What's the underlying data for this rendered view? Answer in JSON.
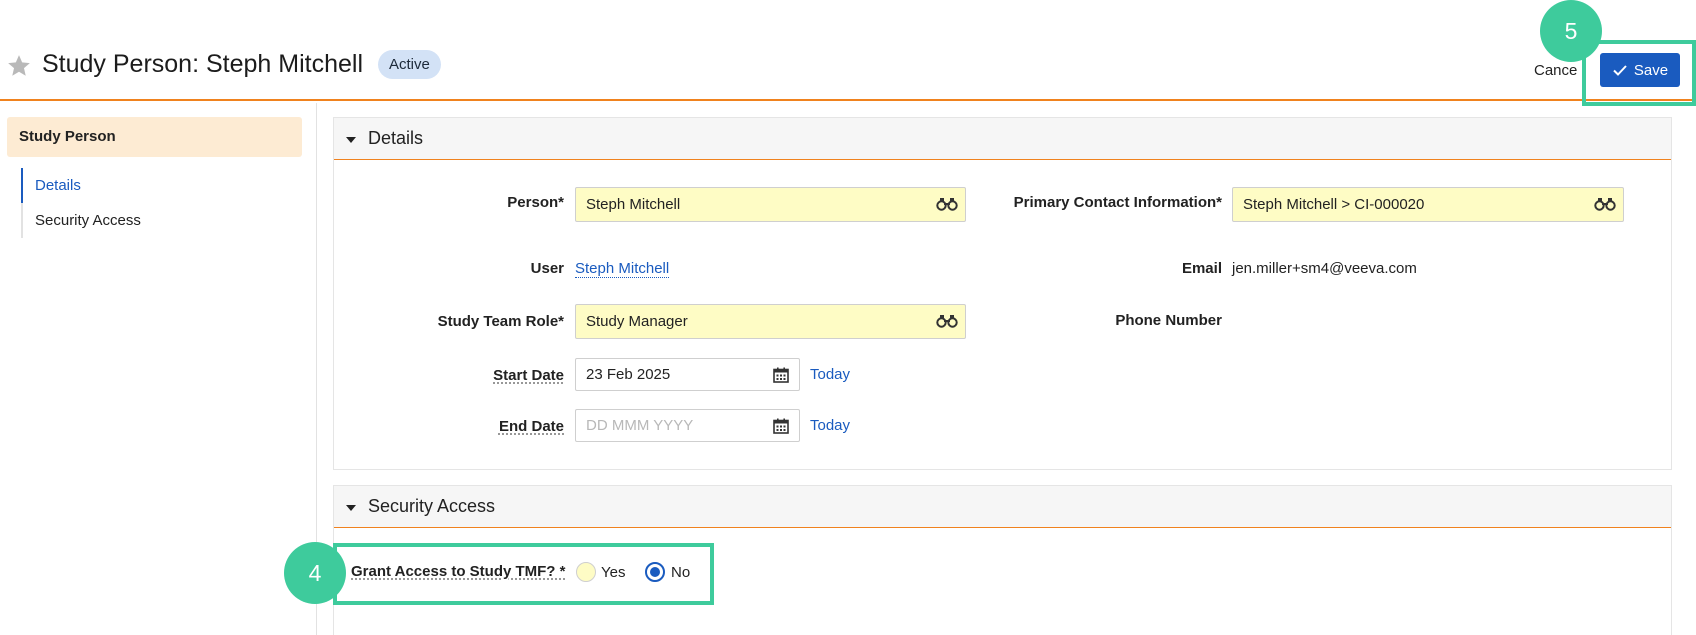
{
  "header": {
    "title": "Study Person: Steph Mitchell",
    "status": "Active",
    "cancel_label": "Cancel",
    "save_label": "Save"
  },
  "callouts": {
    "save_step": "5",
    "grant_step": "4"
  },
  "sidebar": {
    "header": "Study Person",
    "items": [
      {
        "label": "Details",
        "active": true
      },
      {
        "label": "Security Access",
        "active": false
      }
    ]
  },
  "details": {
    "title": "Details",
    "person_label": "Person*",
    "person_value": "Steph Mitchell",
    "primary_contact_label": "Primary Contact Information*",
    "primary_contact_value": "Steph Mitchell > CI-000020",
    "user_label": "User",
    "user_value": "Steph Mitchell",
    "email_label": "Email",
    "email_value": "jen.miller+sm4@veeva.com",
    "role_label": "Study Team Role*",
    "role_value": "Study Manager",
    "phone_label": "Phone Number",
    "start_date_label": "Start Date",
    "start_date_value": "23 Feb 2025",
    "end_date_label": "End Date",
    "end_date_placeholder": "DD MMM YYYY",
    "today_label": "Today"
  },
  "security": {
    "title": "Security Access",
    "grant_label": "Grant Access to Study TMF? *",
    "yes_label": "Yes",
    "no_label": "No",
    "selected": "No"
  },
  "colors": {
    "accent": "#f0821e",
    "primary": "#1a5bbf",
    "callout": "#3ecb9c",
    "required_field": "#fefcc5"
  },
  "icons": [
    "star-icon",
    "checkmark-icon",
    "binoculars-icon",
    "calendar-icon",
    "caret-down-icon"
  ]
}
